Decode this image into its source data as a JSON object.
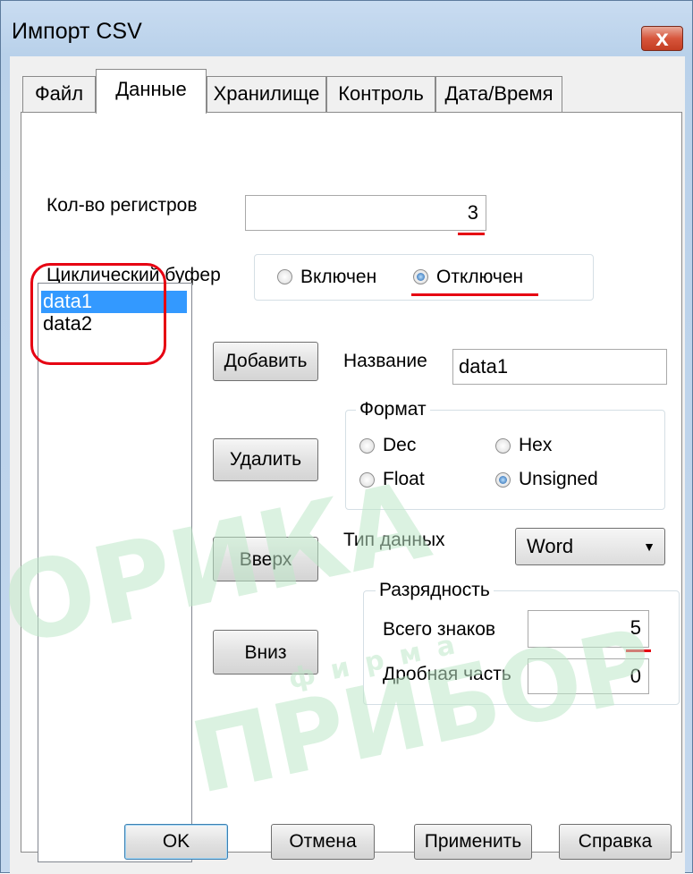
{
  "window": {
    "title": "Импорт CSV",
    "close_label": "x"
  },
  "tabs": [
    {
      "label": "Файл"
    },
    {
      "label": "Данные"
    },
    {
      "label": "Хранилище"
    },
    {
      "label": "Контроль"
    },
    {
      "label": "Дата/Время"
    }
  ],
  "active_tab": "Данные",
  "registers": {
    "label": "Кол-во регистров",
    "value": "3"
  },
  "cyclic_buffer": {
    "label": "Циклический буфер",
    "options": [
      "Включен",
      "Отключен"
    ],
    "selected": "Отключен"
  },
  "data_list": {
    "items": [
      "data1",
      "data2"
    ],
    "selected": "data1"
  },
  "buttons": {
    "add": "Добавить",
    "delete": "Удалить",
    "up": "Вверх",
    "down": "Вниз"
  },
  "name_field": {
    "label": "Название",
    "value": "data1"
  },
  "format": {
    "title": "Формат",
    "options": [
      "Dec",
      "Hex",
      "Float",
      "Unsigned"
    ],
    "selected": "Unsigned"
  },
  "data_type": {
    "label": "Тип данных",
    "value": "Word"
  },
  "digits": {
    "title": "Разрядность",
    "total_label": "Всего знаков",
    "total_value": "5",
    "fraction_label": "Дробная часть",
    "fraction_value": "0"
  },
  "footer": {
    "ok": "OK",
    "cancel": "Отмена",
    "apply": "Применить",
    "help": "Справка"
  },
  "watermark": {
    "line1": "ОРИКА",
    "line2": "фирма",
    "line3": "ПРИБОР"
  },
  "colors": {
    "accent": "#3399ff",
    "annotation": "#e60012",
    "watermark": "#bfe8c9"
  }
}
